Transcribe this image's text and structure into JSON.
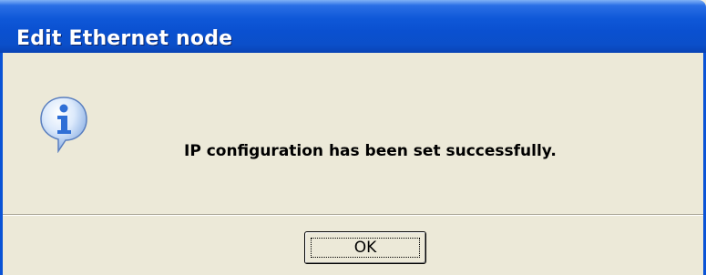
{
  "window": {
    "title": "Edit Ethernet node"
  },
  "dialog": {
    "icon": "info-icon",
    "message": "IP configuration has been set successfully.",
    "ok_label": "OK"
  },
  "colors": {
    "titlebar": "#0a50d0",
    "dialog_background": "#ece9d8",
    "icon_blue": "#2f6fd6"
  }
}
